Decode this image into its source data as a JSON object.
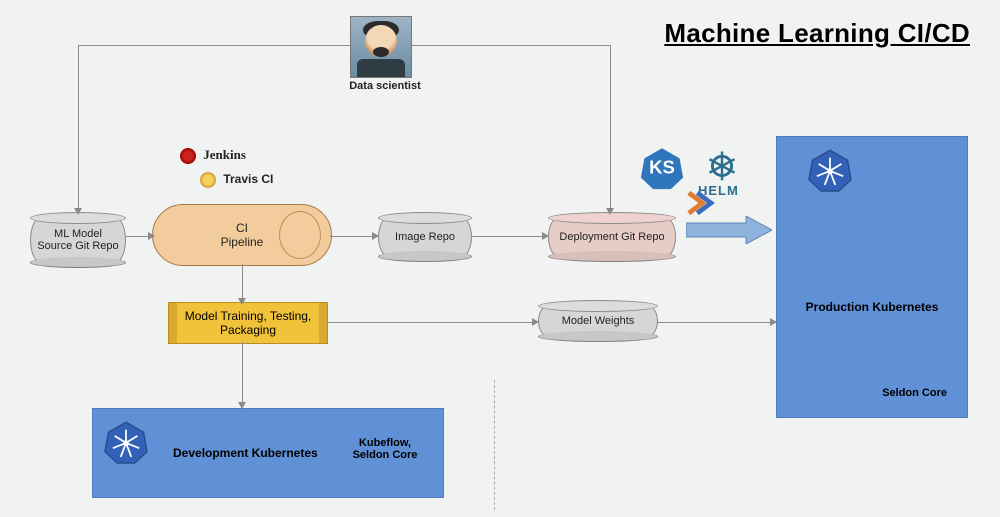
{
  "title": "Machine Learning CI/CD",
  "avatar_label": "Data scientist",
  "nodes": {
    "source_repo": "ML Model Source Git Repo",
    "ci_pipeline": "CI\nPipeline",
    "image_repo": "Image Repo",
    "deploy_repo": "Deployment Git Repo",
    "training": "Model Training, Testing, Packaging",
    "weights": "Model Weights",
    "dev_k8s": "Development Kubernetes",
    "dev_k8s_sub": "Kubeflow, Seldon Core",
    "prod_k8s": "Production Kubernetes",
    "prod_k8s_sub": "Seldon Core"
  },
  "tools": {
    "jenkins": "Jenkins",
    "travis": "Travis CI",
    "helm": "HELM",
    "ksonnet": "KS"
  },
  "chart_data": {
    "type": "diagram",
    "title": "Machine Learning CI/CD",
    "actors": [
      "Data scientist"
    ],
    "nodes": [
      {
        "id": "source_repo",
        "label": "ML Model Source Git Repo",
        "kind": "repo"
      },
      {
        "id": "ci_pipeline",
        "label": "CI Pipeline",
        "kind": "process",
        "tools": [
          "Jenkins",
          "Travis CI"
        ]
      },
      {
        "id": "image_repo",
        "label": "Image Repo",
        "kind": "repo"
      },
      {
        "id": "deploy_repo",
        "label": "Deployment Git Repo",
        "kind": "repo"
      },
      {
        "id": "training",
        "label": "Model Training, Testing, Packaging",
        "kind": "process"
      },
      {
        "id": "weights",
        "label": "Model Weights",
        "kind": "artifact"
      },
      {
        "id": "dev_k8s",
        "label": "Development Kubernetes",
        "kind": "cluster",
        "sub": "Kubeflow, Seldon Core"
      },
      {
        "id": "prod_k8s",
        "label": "Production Kubernetes",
        "kind": "cluster",
        "sub": "Seldon Core",
        "tools": [
          "ksonnet",
          "Helm",
          "Argo"
        ]
      }
    ],
    "edges": [
      {
        "from": "Data scientist",
        "to": "source_repo"
      },
      {
        "from": "Data scientist",
        "to": "deploy_repo"
      },
      {
        "from": "source_repo",
        "to": "ci_pipeline"
      },
      {
        "from": "ci_pipeline",
        "to": "image_repo"
      },
      {
        "from": "ci_pipeline",
        "to": "training"
      },
      {
        "from": "image_repo",
        "to": "deploy_repo"
      },
      {
        "from": "training",
        "to": "weights"
      },
      {
        "from": "training",
        "to": "dev_k8s"
      },
      {
        "from": "deploy_repo",
        "to": "prod_k8s"
      },
      {
        "from": "weights",
        "to": "prod_k8s"
      }
    ]
  }
}
